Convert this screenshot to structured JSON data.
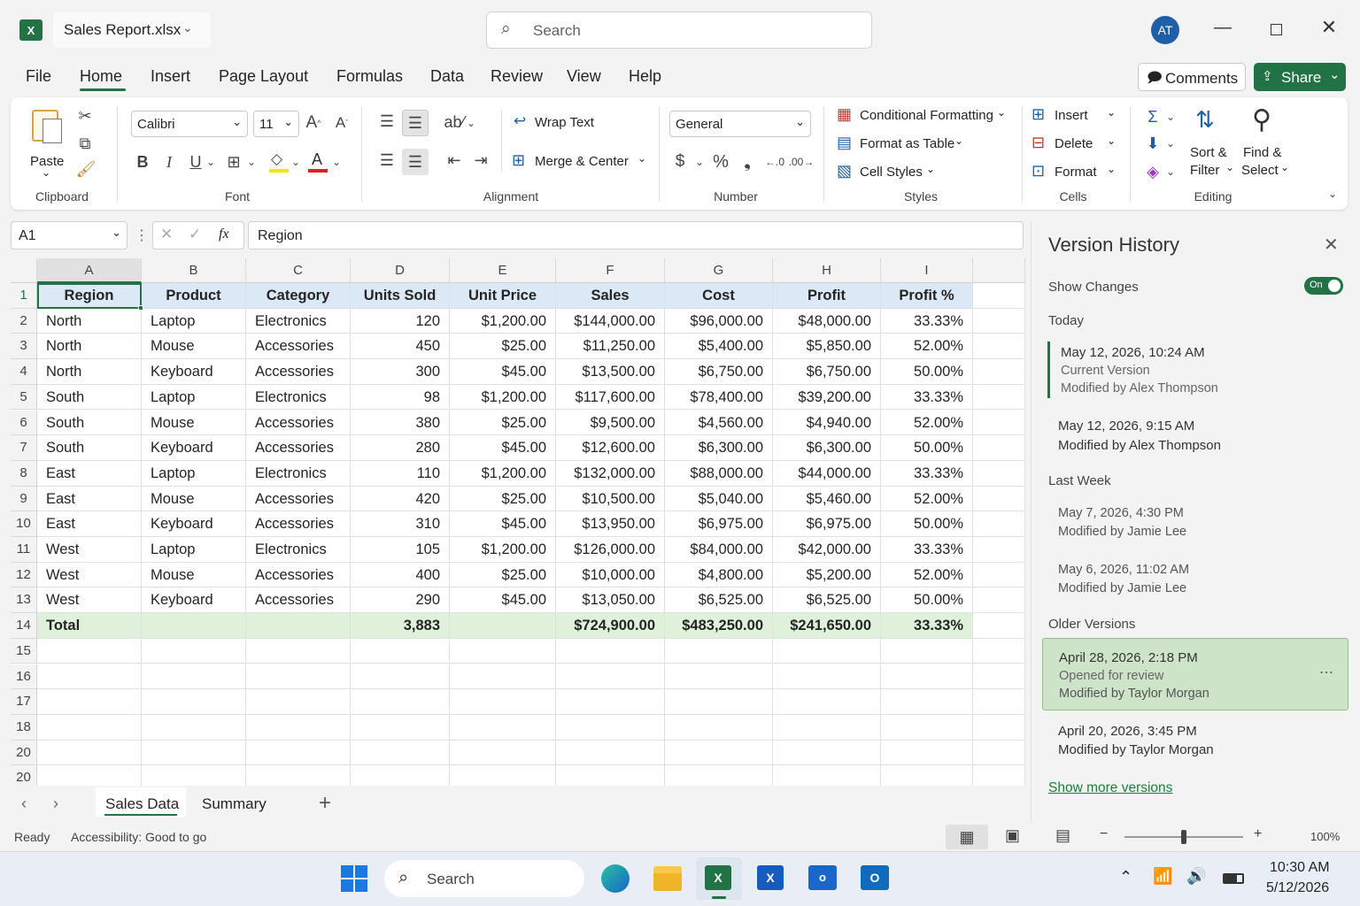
{
  "app": {
    "file_name": "Sales Report.xlsx",
    "search_placeholder": "Search",
    "avatar_initials": "AT",
    "accent": "#217346",
    "avatar_color": "#1f5fa8"
  },
  "ribbon_tabs": [
    "File",
    "Home",
    "Insert",
    "Page Layout",
    "Formulas",
    "Data",
    "Review",
    "View",
    "Help"
  ],
  "active_tab": "Home",
  "header_buttons": {
    "comments": "Comments",
    "share": "Share"
  },
  "ribbon": {
    "clipboard": {
      "paste": "Paste",
      "label": "Clipboard"
    },
    "font": {
      "name": "Calibri",
      "size": "11",
      "label": "Font"
    },
    "alignment": {
      "wrap": "Wrap Text",
      "merge": "Merge & Center",
      "label": "Alignment"
    },
    "number": {
      "format": "General",
      "label": "Number",
      "currency": "$",
      "percent": "%"
    },
    "styles": {
      "cond": "Conditional Formatting",
      "table": "Format as Table",
      "cell": "Cell Styles",
      "label": "Styles"
    },
    "cells": {
      "insert": "Insert",
      "delete": "Delete",
      "format": "Format",
      "label": "Cells"
    },
    "editing": {
      "sort_1": "Sort &",
      "sort_2": "Filter",
      "find_1": "Find &",
      "find_2": "Select",
      "label": "Editing"
    }
  },
  "formula_bar": {
    "name_box": "A1",
    "content": "Region",
    "fx": "fx"
  },
  "sheet": {
    "columns": [
      "A",
      "B",
      "C",
      "D",
      "E",
      "F",
      "G",
      "H",
      "I"
    ],
    "row_numbers": [
      "1",
      "2",
      "3",
      "4",
      "5",
      "6",
      "7",
      "8",
      "9",
      "10",
      "11",
      "12",
      "13",
      "14",
      "15",
      "16",
      "17",
      "18",
      "20",
      "20"
    ],
    "header_row": [
      "Region",
      "Product",
      "Category",
      "Units Sold",
      "Unit Price",
      "Sales",
      "Cost",
      "Profit",
      "Profit %"
    ],
    "rows": [
      [
        "North",
        "Laptop",
        "Electronics",
        "120",
        "$1,200.00",
        "$144,000.00",
        "$96,000.00",
        "$48,000.00",
        "33.33%"
      ],
      [
        "North",
        "Mouse",
        "Accessories",
        "450",
        "$25.00",
        "$11,250.00",
        "$5,400.00",
        "$5,850.00",
        "52.00%"
      ],
      [
        "North",
        "Keyboard",
        "Accessories",
        "300",
        "$45.00",
        "$13,500.00",
        "$6,750.00",
        "$6,750.00",
        "50.00%"
      ],
      [
        "South",
        "Laptop",
        "Electronics",
        "98",
        "$1,200.00",
        "$117,600.00",
        "$78,400.00",
        "$39,200.00",
        "33.33%"
      ],
      [
        "South",
        "Mouse",
        "Accessories",
        "380",
        "$25.00",
        "$9,500.00",
        "$4,560.00",
        "$4,940.00",
        "52.00%"
      ],
      [
        "South",
        "Keyboard",
        "Accessories",
        "280",
        "$45.00",
        "$12,600.00",
        "$6,300.00",
        "$6,300.00",
        "50.00%"
      ],
      [
        "East",
        "Laptop",
        "Electronics",
        "110",
        "$1,200.00",
        "$132,000.00",
        "$88,000.00",
        "$44,000.00",
        "33.33%"
      ],
      [
        "East",
        "Mouse",
        "Accessories",
        "420",
        "$25.00",
        "$10,500.00",
        "$5,040.00",
        "$5,460.00",
        "52.00%"
      ],
      [
        "East",
        "Keyboard",
        "Accessories",
        "310",
        "$45.00",
        "$13,950.00",
        "$6,975.00",
        "$6,975.00",
        "50.00%"
      ],
      [
        "West",
        "Laptop",
        "Electronics",
        "105",
        "$1,200.00",
        "$126,000.00",
        "$84,000.00",
        "$42,000.00",
        "33.33%"
      ],
      [
        "West",
        "Mouse",
        "Accessories",
        "400",
        "$25.00",
        "$10,000.00",
        "$4,800.00",
        "$5,200.00",
        "52.00%"
      ],
      [
        "West",
        "Keyboard",
        "Accessories",
        "290",
        "$45.00",
        "$13,050.00",
        "$6,525.00",
        "$6,525.00",
        "50.00%"
      ]
    ],
    "total_row": [
      "Total",
      "",
      "",
      "3,883",
      "",
      "$724,900.00",
      "$483,250.00",
      "$241,650.00",
      "33.33%"
    ]
  },
  "sheet_tabs": [
    "Sales Data",
    "Summary"
  ],
  "active_sheet": "Sales Data",
  "version_history": {
    "title": "Version History",
    "show_changes": "Show Changes",
    "toggle_state": "On",
    "groups": [
      {
        "label": "Today",
        "items": [
          {
            "date": "May 12, 2026, 10:24 AM",
            "note": "Current Version",
            "by": "Modified by Alex Thompson"
          },
          {
            "date": "May 12, 2026, 9:15 AM",
            "note": "",
            "by": "Modified by Alex Thompson"
          }
        ]
      },
      {
        "label": "Last Week",
        "items": [
          {
            "date": "May 7, 2026, 4:30 PM",
            "note": "",
            "by": "Modified by Jamie Lee"
          },
          {
            "date": "May 6, 2026, 11:02 AM",
            "note": "",
            "by": "Modified by Jamie Lee"
          }
        ]
      },
      {
        "label": "Older Versions",
        "items": [
          {
            "date": "April 28, 2026, 2:18 PM",
            "note": "Opened for review",
            "by": "Modified by Taylor Morgan"
          },
          {
            "date": "April 20, 2026, 3:45 PM",
            "note": "",
            "by": "Modified by Taylor Morgan"
          }
        ]
      }
    ],
    "more": "Show more versions"
  },
  "status_bar": {
    "ready": "Ready",
    "accessibility": "Accessibility: Good to go",
    "zoom": "100%",
    "zoom_level": 0.5
  },
  "taskbar": {
    "search": "Search",
    "time": "10:30 AM",
    "date": "5/12/2026"
  }
}
